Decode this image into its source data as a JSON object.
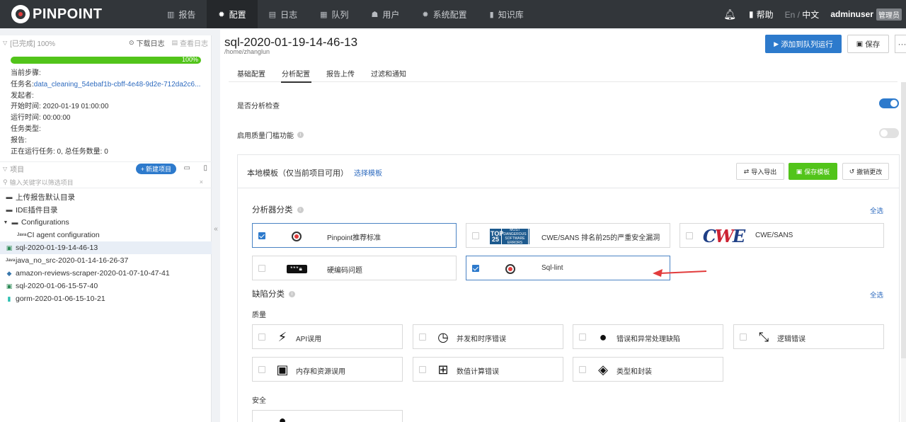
{
  "app": {
    "logo_text": "PINPOINT"
  },
  "nav": {
    "items": [
      {
        "label": "报告",
        "icon": "bar-chart-icon"
      },
      {
        "label": "配置",
        "icon": "gear-icon"
      },
      {
        "label": "日志",
        "icon": "calendar-icon"
      },
      {
        "label": "队列",
        "icon": "queue-icon"
      },
      {
        "label": "用户",
        "icon": "users-icon"
      },
      {
        "label": "系统配置",
        "icon": "gear-icon"
      },
      {
        "label": "知识库",
        "icon": "book-icon"
      }
    ],
    "active": "配置",
    "help": "帮助",
    "lang_en": "En",
    "lang_sep": " / ",
    "lang_zh": "中文",
    "user": "adminuser",
    "role": "管理员"
  },
  "sidebar": {
    "status": "[已完成] 100%",
    "download_log": "下载日志",
    "view_log": "查看日志",
    "progress_label": "100%",
    "progress": 1.0,
    "info": {
      "current_step_label": "当前步骤:",
      "task_name_label": "任务名:",
      "task_name_value": "data_cleaning_54ebaf1b-cbff-4e48-9d2e-712da2c6...",
      "initiator_label": "发起者:",
      "start_time": "开始时间: 2020-01-19 01:00:00",
      "run_time": "运行时间: 00:00:00",
      "task_type_label": "任务类型:",
      "report_label": "报告:",
      "running": "正在运行任务: 0, 总任务数量: 0"
    },
    "projects_label": "项目",
    "new_project": "新建项目",
    "filter_placeholder": "输入关键字以筛选项目",
    "tree": [
      {
        "label": "上传报告默认目录",
        "icon": "folder-icon",
        "level": 1
      },
      {
        "label": "IDE插件目录",
        "icon": "folder-icon",
        "level": 1
      },
      {
        "label": "Configurations",
        "icon": "folder-open-icon",
        "level": 1
      },
      {
        "label": "CI agent configuration",
        "icon": "java-icon",
        "level": 2
      },
      {
        "label": "sql-2020-01-19-14-46-13",
        "icon": "database-icon",
        "level": 1
      },
      {
        "label": "java_no_src-2020-01-14-16-26-37",
        "icon": "java-icon",
        "level": 1
      },
      {
        "label": "amazon-reviews-scraper-2020-01-07-10-47-41",
        "icon": "python-icon",
        "level": 1
      },
      {
        "label": "sql-2020-01-06-15-57-40",
        "icon": "database-icon",
        "level": 1
      },
      {
        "label": "gorm-2020-01-06-15-10-21",
        "icon": "go-icon",
        "level": 1
      }
    ]
  },
  "main": {
    "title": "sql-2020-01-19-14-46-13",
    "path": "/home/zhanglun",
    "run_button": "添加到队列运行",
    "save_button": "保存",
    "more_button": "···",
    "tabs": [
      "基础配置",
      "分析配置",
      "报告上传",
      "过滤和通知"
    ],
    "active_tab": "分析配置",
    "options": {
      "analysis_check": "是否分析检查",
      "analysis_check_on": true,
      "quality_gate": "启用质量门槛功能",
      "quality_gate_on": false
    },
    "template": {
      "title": "本地模板（仅当前项目可用）",
      "select_link": "选择模板",
      "import_export": "导入导出",
      "save_template": "保存模板",
      "undo": "撤销更改"
    },
    "analyzer_section": "分析器分类",
    "select_all": "全选",
    "analyzers": [
      {
        "label": "Pinpoint推荐标准",
        "checked": true
      },
      {
        "label": "CWE/SANS 排名前25的严重安全漏洞",
        "checked": false
      },
      {
        "label": "CWE/SANS",
        "checked": false
      },
      {
        "label": "硬编码问题",
        "checked": false
      },
      {
        "label": "Sql-lint",
        "checked": true
      }
    ],
    "defect_section": "缺陷分类",
    "quality_label": "质量",
    "defects": [
      {
        "label": "API误用",
        "icon": "plug-icon"
      },
      {
        "label": "并发和时序错误",
        "icon": "clock-icon"
      },
      {
        "label": "错误和异常处理缺陷",
        "icon": "bomb-icon"
      },
      {
        "label": "逻辑错误",
        "icon": "compress-arrows-icon"
      },
      {
        "label": "内存和资源误用",
        "icon": "chip-icon"
      },
      {
        "label": "数值计算错误",
        "icon": "calculator-icon"
      },
      {
        "label": "类型和封装",
        "icon": "shapes-icon"
      }
    ],
    "security_label": "安全"
  },
  "colors": {
    "accent": "#2d7acc",
    "success": "#52c41a",
    "nav_bg": "#32363a",
    "annotation_arrow": "#e23c3c"
  }
}
